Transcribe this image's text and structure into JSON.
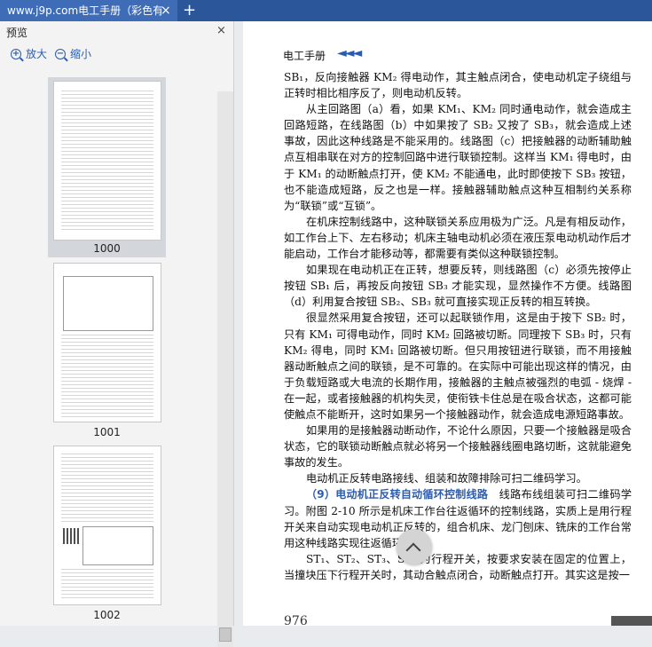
{
  "tab": {
    "title": "www.j9p.com电工手册（彩色有",
    "close": "×",
    "new": "+"
  },
  "sidebar": {
    "title": "预览",
    "close": "×",
    "zoom_in": "放大",
    "zoom_out": "缩小",
    "thumbs": [
      "1000",
      "1001",
      "1002"
    ],
    "thumb_header": "电工手册"
  },
  "page": {
    "header": "电工手册",
    "header_mark": "◄◄◄",
    "number": "976",
    "paragraphs": [
      "SB₁，反向接触器 KM₂ 得电动作，其主触点闭合，使电动机定子绕组与正转时相比相序反了，则电动机反转。",
      "从主回路图（a）看，如果 KM₁、KM₂ 同时通电动作，就会造成主回路短路，在线路图（b）中如果按了 SB₂ 又按了 SB₃，就会造成上述事故，因此这种线路是不能采用的。线路图（c）把接触器的动断辅助触点互相串联在对方的控制回路中进行联锁控制。这样当 KM₁ 得电时，由于 KM₁ 的动断触点打开，使 KM₂ 不能通电，此时即使按下 SB₃ 按钮，也不能造成短路，反之也是一样。接触器辅助触点这种互相制约关系称为“联锁”或“互锁”。",
      "在机床控制线路中，这种联锁关系应用极为广泛。凡是有相反动作，如工作台上下、左右移动；机床主轴电动机必须在液压泵电动机动作后才能启动，工作台才能移动等，都需要有类似这种联锁控制。",
      "如果现在电动机正在正转，想要反转，则线路图（c）必须先按停止按钮 SB₁ 后，再按反向按钮 SB₃ 才能实现，显然操作不方便。线路图（d）利用复合按钮 SB₂、SB₃ 就可直接实现正反转的相互转换。",
      "很显然采用复合按钮，还可以起联锁作用，这是由于按下 SB₂ 时，只有 KM₁ 可得电动作，同时 KM₂ 回路被切断。同理按下 SB₃ 时，只有 KM₂ 得电，同时 KM₁ 回路被切断。但只用按钮进行联锁，而不用接触器动断触点之间的联锁，是不可靠的。在实际中可能出现这样的情况，由于负载短路或大电流的长期作用，接触器的主触点被强烈的电弧 - 烧焊 - 在一起，或者接触器的机构失灵，使衔铁卡住总是在吸合状态，这都可能使触点不能断开，这时如果另一个接触器动作，就会造成电源短路事故。",
      "如果用的是接触器动断动作，不论什么原因，只要一个接触器是吸合状态，它的联锁动断触点就必将另一个接触器线圈电路切断，这就能避免事故的发生。",
      "电动机正反转电路接线、组装和故障排除可扫二维码学习。"
    ],
    "section_title": "（9）电动机正反转自动循环控制线路",
    "section_text": "线路布线组装可扫二维码学习。附图 2-10 所示是机床工作台往返循环的控制线路，实质上是用行程开关来自动实现电动机正反转的，组合机床、龙门刨床、铣床的工作台常用这种线路实现往返循环。",
    "last_paragraph": "ST₁、ST₂、ST₃、ST₄ 为行程开关，按要求安装在固定的位置上，当撞块压下行程开关时，其动合触点闭合，动断触点打开。其实这是按一"
  }
}
